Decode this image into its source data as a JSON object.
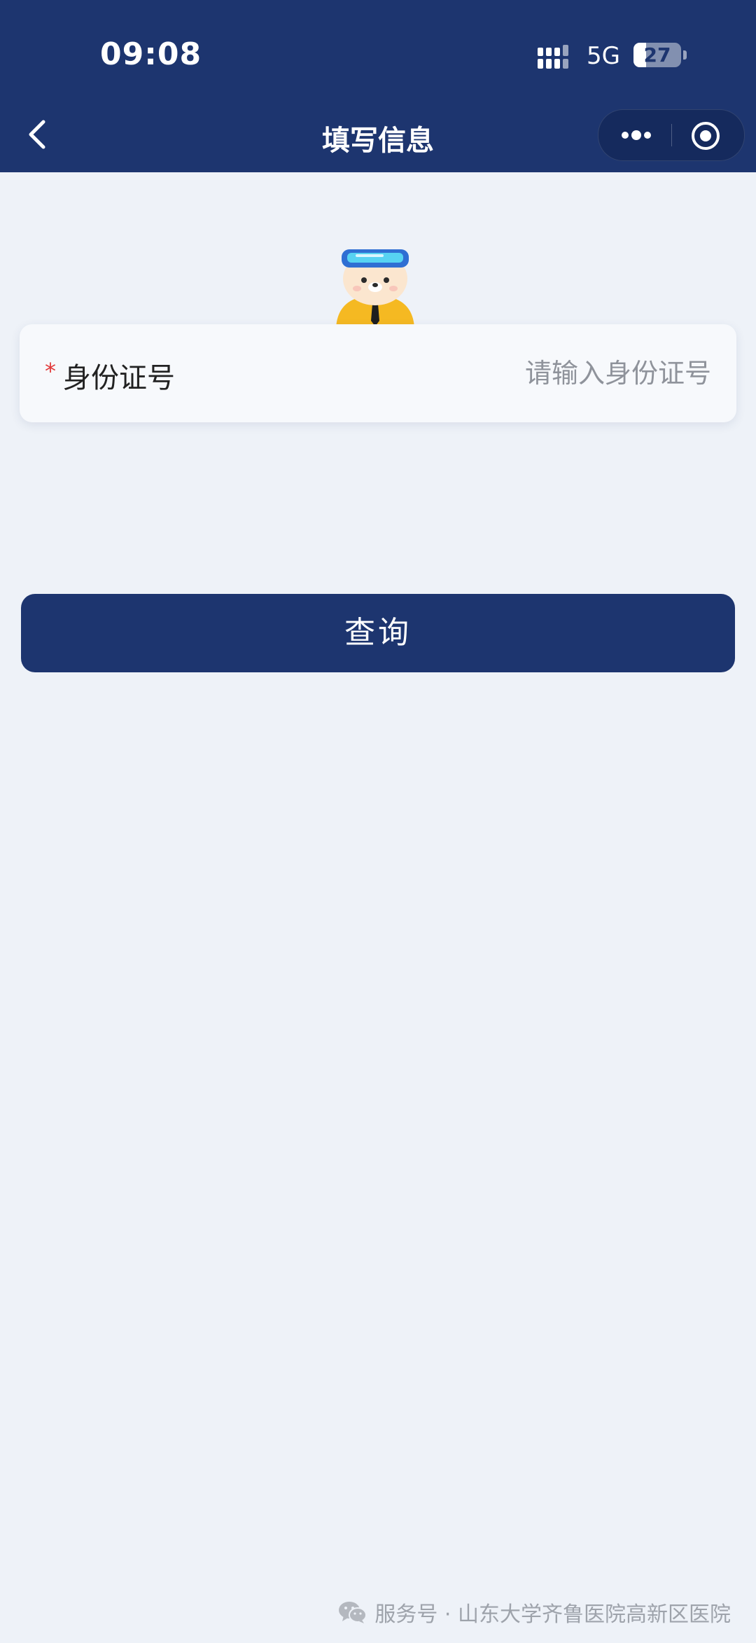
{
  "status_bar": {
    "time": "09:08",
    "network": "5G",
    "battery": "27",
    "battery_level": 0.27
  },
  "nav": {
    "back_icon": "chevron-left-icon",
    "title": "填写信息",
    "more_icon": "more-dots-icon",
    "close_icon": "target-close-icon"
  },
  "form": {
    "required_mark": "*",
    "id_label": "身份证号",
    "id_value": "",
    "id_placeholder": "请输入身份证号"
  },
  "actions": {
    "query_label": "查询"
  },
  "footer": {
    "icon": "wechat-icon",
    "text": "服务号 · 山东大学齐鲁医院高新区医院"
  },
  "colors": {
    "primary": "#1d356f",
    "background": "#eef2f8",
    "required": "#e23a3a",
    "placeholder": "#8f939b",
    "mascot_yellow": "#f5b922"
  }
}
